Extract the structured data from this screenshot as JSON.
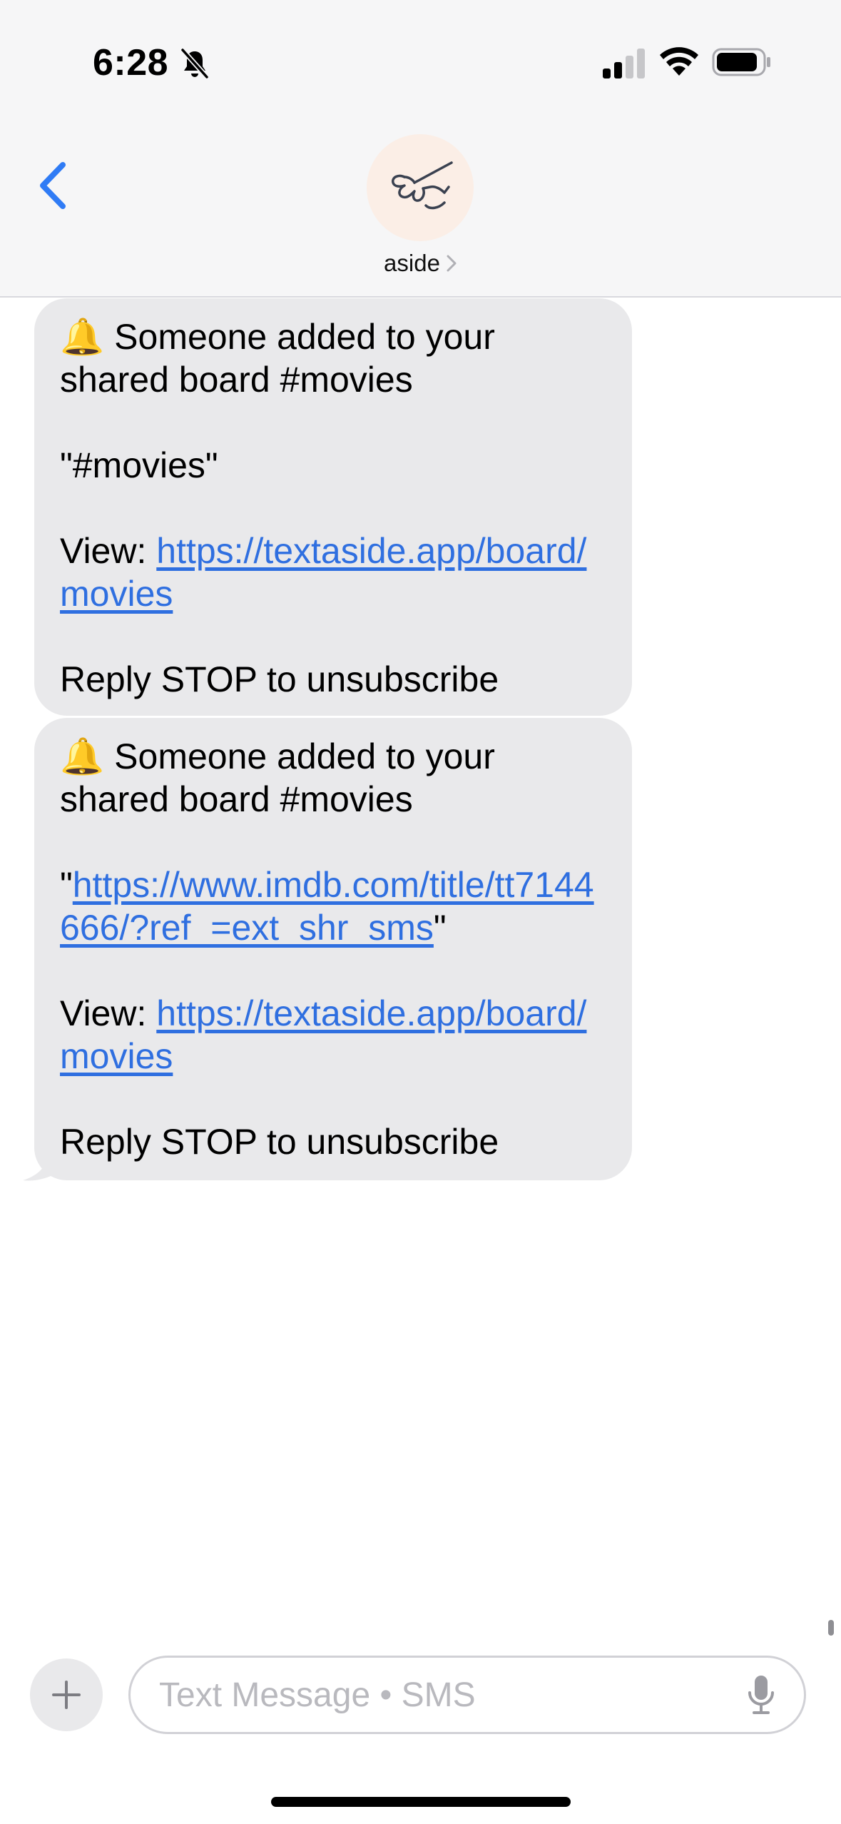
{
  "status_bar": {
    "time": "6:28",
    "icons": [
      "bell-slash-icon",
      "cellular-signal-icon",
      "wifi-icon",
      "battery-icon"
    ]
  },
  "header": {
    "back_icon": "chevron-left-icon",
    "contact_name": "aside",
    "avatar_icon": "pointing-hand-icon",
    "accent_color": "#2f7bf5",
    "avatar_bg": "#fbeee6"
  },
  "messages": [
    {
      "emoji": "🔔",
      "line1": " Someone added to your shared board #movies",
      "quote": "\"#movies\"",
      "view_prefix": "View: ",
      "view_link": "https://textaside.app/board/movies",
      "footer": "Reply STOP to unsubscribe"
    },
    {
      "emoji": "🔔",
      "line1": " Someone added to your shared board #movies",
      "quote_open": "\"",
      "quote_link": "https://www.imdb.com/title/tt7144666/?ref_=ext_shr_sms",
      "quote_close": "\"",
      "view_prefix": "View: ",
      "view_link": "https://textaside.app/board/movies",
      "footer": "Reply STOP to unsubscribe"
    }
  ],
  "composer": {
    "add_icon": "plus-icon",
    "placeholder": "Text Message • SMS",
    "value": "",
    "mic_icon": "microphone-icon"
  },
  "colors": {
    "bubble_bg": "#e9e9eb",
    "link": "#2f6fe0",
    "header_bg": "#f6f6f7"
  }
}
